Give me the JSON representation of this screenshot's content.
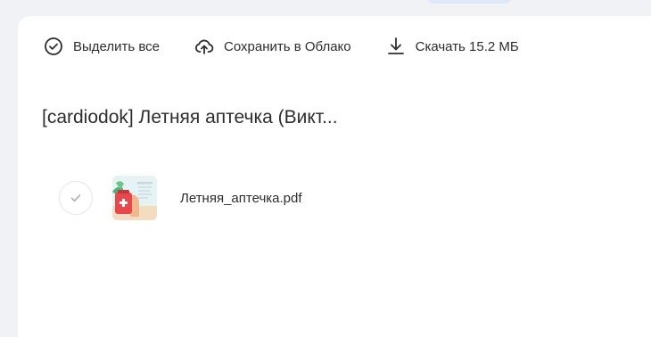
{
  "toolbar": {
    "select_all_label": "Выделить все",
    "save_cloud_label": "Сохранить в Облако",
    "download_label": "Скачать 15.2 МБ",
    "icons": [
      "check-circle-icon",
      "cloud-upload-icon",
      "download-icon"
    ]
  },
  "folder": {
    "title": "[cardiodok] Летняя аптечка (Викт..."
  },
  "files": [
    {
      "name": "Летняя_аптечка.pdf",
      "selected": false
    }
  ],
  "colors": {
    "background": "#f0f2f5",
    "panel": "#ffffff",
    "text": "#2c2d2e",
    "top_tab": "#dfe8f7"
  }
}
